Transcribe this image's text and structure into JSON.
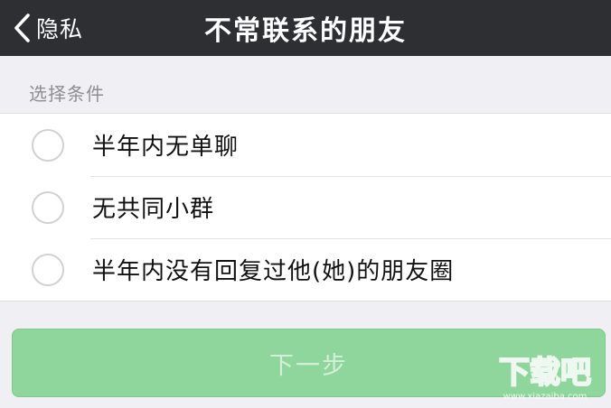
{
  "navbar": {
    "back_label": "隐私",
    "title": "不常联系的朋友"
  },
  "section": {
    "header": "选择条件"
  },
  "options": [
    {
      "label": "半年内无单聊",
      "selected": false
    },
    {
      "label": "无共同小群",
      "selected": false
    },
    {
      "label": "半年内没有回复过他(她)的朋友圈",
      "selected": false
    }
  ],
  "next_button": {
    "label": "下一步",
    "enabled": false
  },
  "watermark": {
    "text": "下载吧",
    "url_text": "www.xiazaiba.com"
  },
  "colors": {
    "navbar_bg": "#2e2f33",
    "page_bg": "#efeff4",
    "button_bg": "#8fd69c",
    "button_text": "#d4efd9"
  },
  "icons": {
    "back": "chevron-left-icon",
    "radio": "radio-unchecked-icon"
  }
}
